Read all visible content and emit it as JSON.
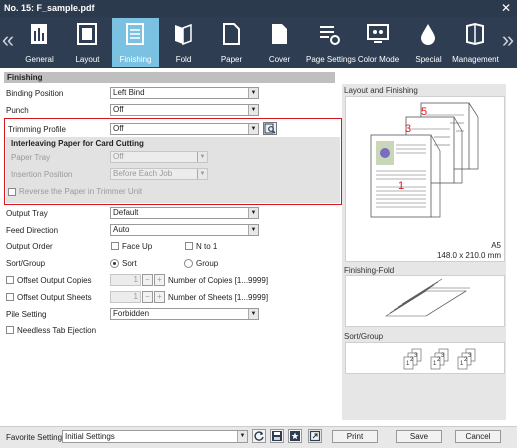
{
  "window": {
    "title": "No. 15: F_sample.pdf"
  },
  "toolbar": {
    "items": [
      {
        "label": "General"
      },
      {
        "label": "Layout"
      },
      {
        "label": "Finishing"
      },
      {
        "label": "Fold"
      },
      {
        "label": "Paper"
      },
      {
        "label": "Cover"
      },
      {
        "label": "Page Settings"
      },
      {
        "label": "Color Mode"
      },
      {
        "label": "Special"
      },
      {
        "label": "Management"
      }
    ],
    "active": "Finishing"
  },
  "section": {
    "title": "Finishing"
  },
  "binding_position": {
    "label": "Binding Position",
    "value": "Left Bind"
  },
  "punch": {
    "label": "Punch",
    "value": "Off"
  },
  "trimming_profile": {
    "label": "Trimming Profile",
    "value": "Off"
  },
  "interleaving": {
    "title": "Interleaving Paper for Card Cutting",
    "paper_tray": {
      "label": "Paper Tray",
      "value": "Off"
    },
    "insertion_position": {
      "label": "Insertion Position",
      "value": "Before Each Job"
    },
    "reverse_label": "Reverse the Paper in Trimmer Unit"
  },
  "output_tray": {
    "label": "Output Tray",
    "value": "Default"
  },
  "feed_direction": {
    "label": "Feed Direction",
    "value": "Auto"
  },
  "output_order": {
    "label": "Output Order",
    "face_up": "Face Up",
    "n_to_1": "N to 1"
  },
  "sort_group": {
    "label": "Sort/Group",
    "sort": "Sort",
    "group": "Group"
  },
  "offset_copies": {
    "label": "Offset Output Copies",
    "value": "1",
    "minus": "−",
    "plus": "+",
    "range": "Number of Copies [1...9999]"
  },
  "offset_sheets": {
    "label": "Offset Output Sheets",
    "value": "1",
    "minus": "−",
    "plus": "+",
    "range": "Number of Sheets [1...9999]"
  },
  "pile_setting": {
    "label": "Pile Setting",
    "value": "Forbidden"
  },
  "needless_tab": {
    "label": "Needless Tab Ejection"
  },
  "preview": {
    "layout_title": "Layout and Finishing",
    "page_numbers": [
      "5",
      "3",
      "1"
    ],
    "paper_size": "A5",
    "paper_dims": "148.0 x 210.0 mm",
    "fold_title": "Finishing-Fold",
    "sort_title": "Sort/Group",
    "sort_nums": [
      "1",
      "2",
      "3",
      "1",
      "2",
      "3",
      "1",
      "2",
      "3"
    ]
  },
  "bottom": {
    "favorite_label": "Favorite Setting",
    "favorite_value": "Initial Settings",
    "print": "Print",
    "save": "Save",
    "cancel": "Cancel"
  },
  "colors": {
    "active_tab": "#7bc1e2",
    "toolbar_bg": "#2f3d52",
    "highlight_border": "#d7161d"
  }
}
